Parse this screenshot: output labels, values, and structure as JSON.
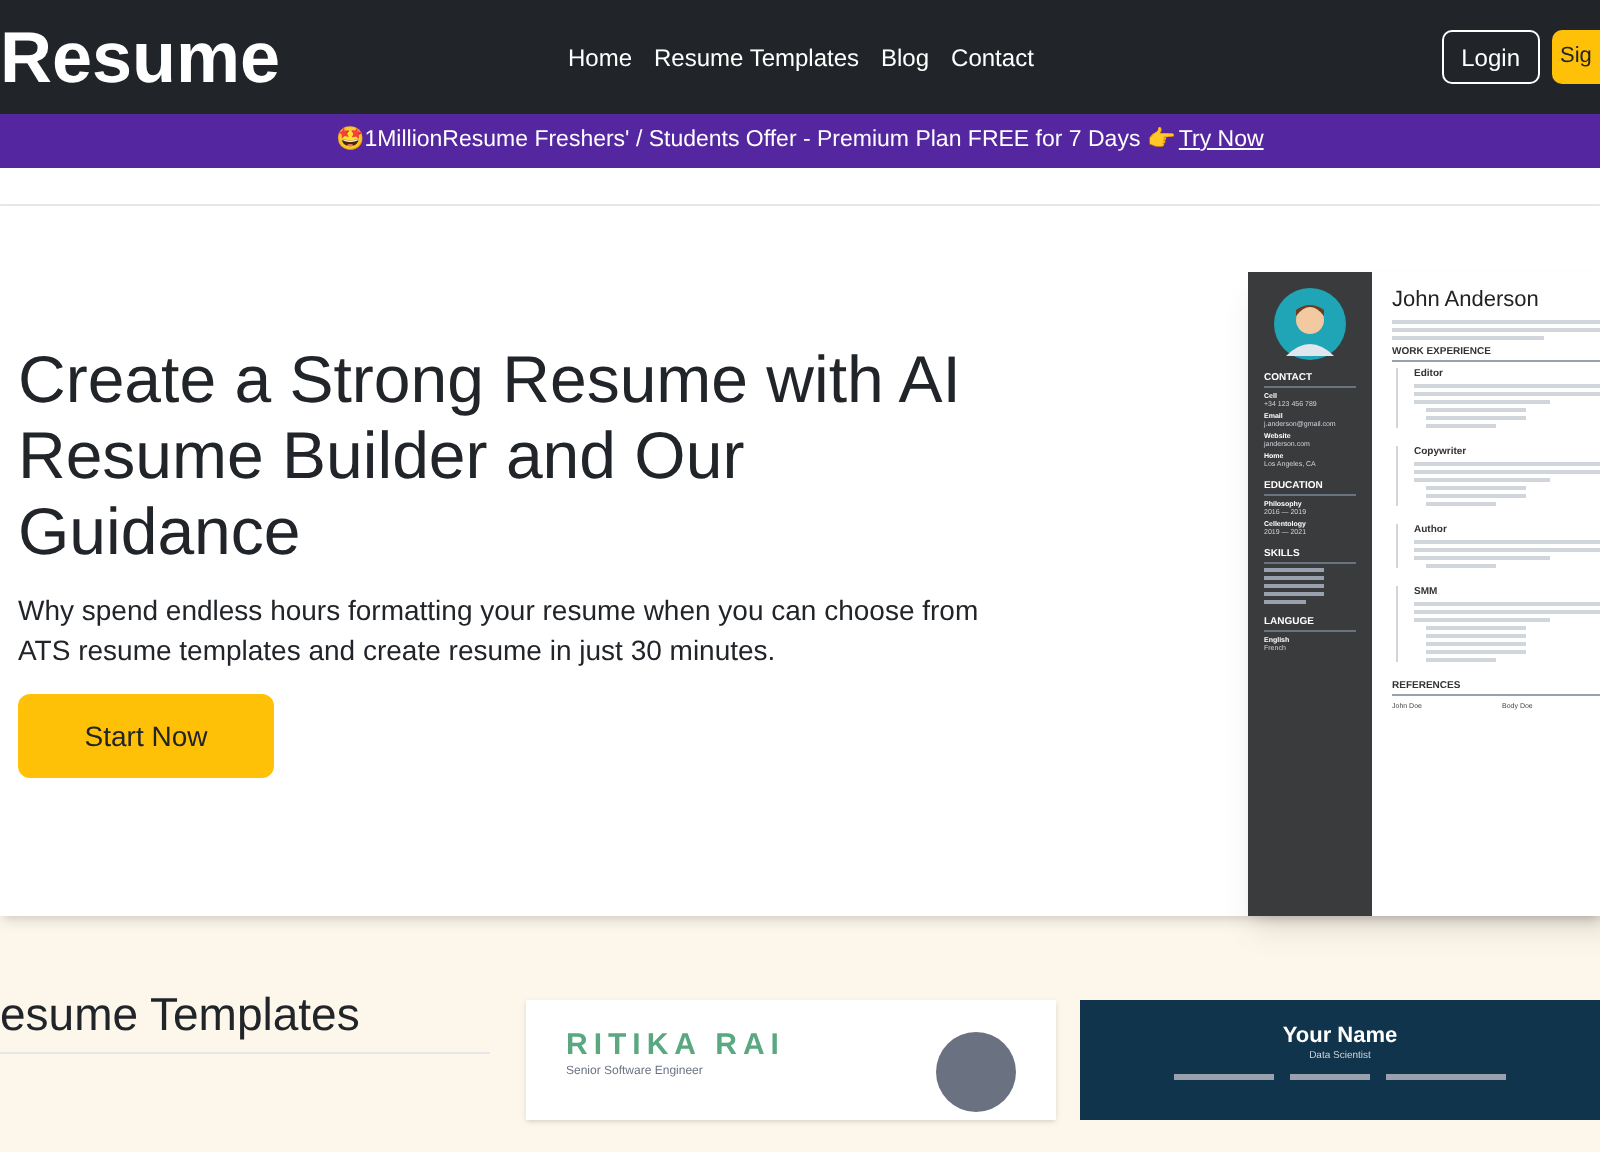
{
  "nav": {
    "logo": "Resume",
    "links": [
      "Home",
      "Resume Templates",
      "Blog",
      "Contact"
    ],
    "login": "Login",
    "signup": "Sig"
  },
  "banner": {
    "emoji": "🤩",
    "text": "1MillionResume Freshers' / Students Offer - Premium Plan FREE for 7 Days",
    "hand": "👉",
    "link": "Try Now"
  },
  "hero": {
    "title": "Create a Strong Resume with AI Resume Builder and Our Guidance",
    "subtitle": "Why spend endless hours formatting your resume when you can choose from ATS resume templates and create resume in just 30 minutes.",
    "cta": "Start Now"
  },
  "preview": {
    "name": "John Anderson",
    "sidebar": [
      {
        "heading": "CONTACT",
        "items": [
          {
            "label": "Cell",
            "value": "+34 123 456 789"
          },
          {
            "label": "Email",
            "value": "j.anderson@gmail.com"
          },
          {
            "label": "Website",
            "value": "janderson.com"
          },
          {
            "label": "Home",
            "value": "Los Angeles, CA"
          }
        ]
      },
      {
        "heading": "EDUCATION",
        "items": [
          {
            "label": "Philosophy",
            "value": "2016 — 2019"
          },
          {
            "label": "Cellentology",
            "value": "2019 — 2021"
          }
        ]
      },
      {
        "heading": "SKILLS"
      },
      {
        "heading": "LANGUGE",
        "items": [
          {
            "label": "English",
            "value": "French"
          }
        ]
      }
    ],
    "section": "WORK EXPERIENCE",
    "jobs": [
      {
        "title": "Editor"
      },
      {
        "title": "Copywriter"
      },
      {
        "title": "Author"
      },
      {
        "title": "SMM"
      }
    ],
    "references": {
      "heading": "REFERENCES",
      "people": [
        "John Doe",
        "Body Doe"
      ]
    }
  },
  "templates": {
    "heading": "esume Templates",
    "cards": [
      {
        "kind": "light",
        "name": "RITIKA RAI",
        "role": "Senior Software Engineer"
      },
      {
        "kind": "dark",
        "name": "Your Name",
        "role": "Data Scientist"
      }
    ]
  }
}
